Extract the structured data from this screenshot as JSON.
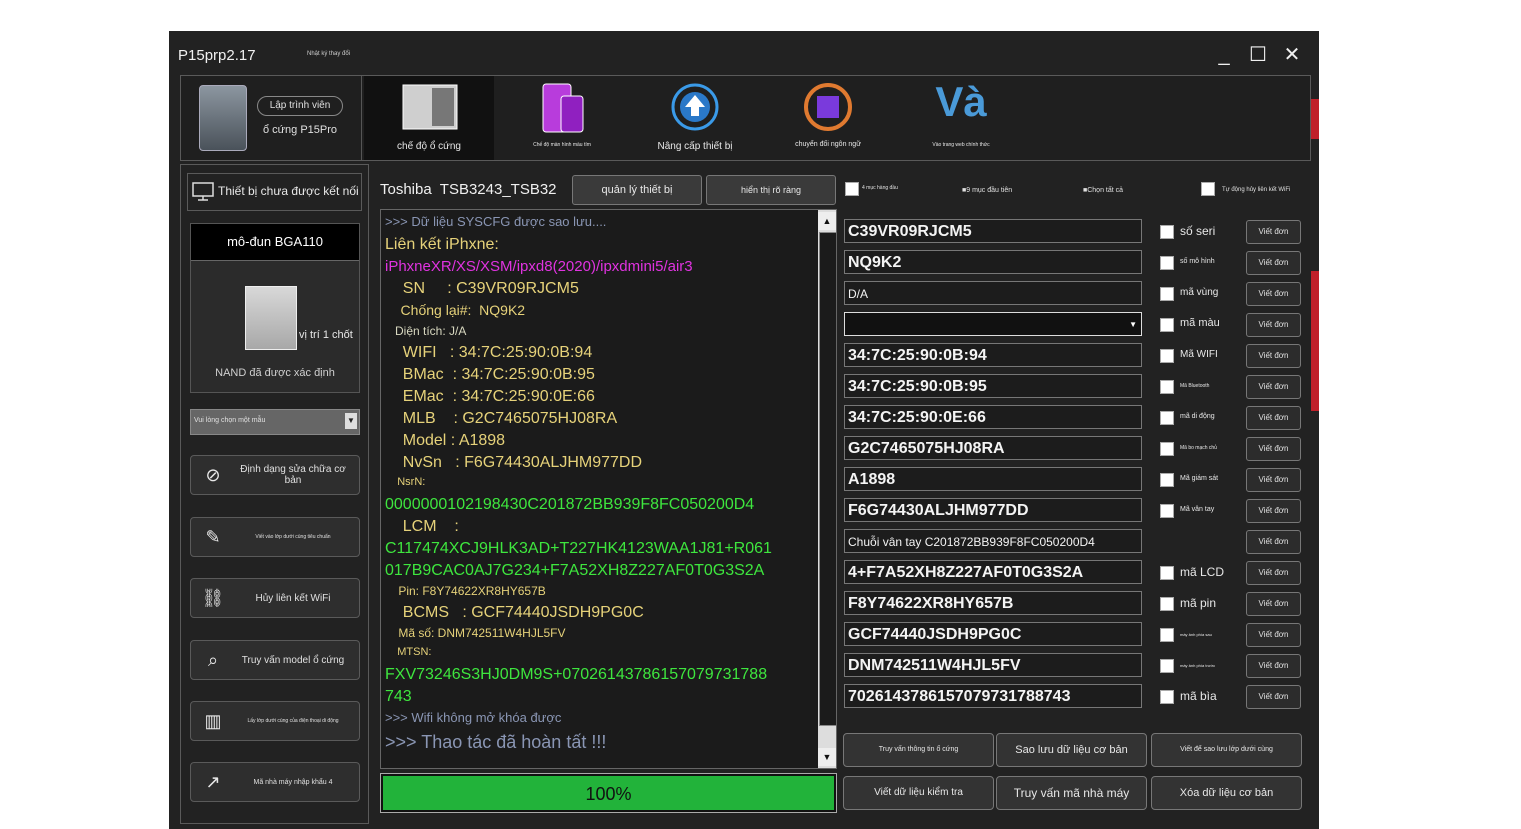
{
  "window": {
    "title": "P15prp2.17",
    "subtitle": "Nhật ký thay đổi",
    "controls": {
      "minimize": "_",
      "maximize": "☐",
      "close": "✕"
    }
  },
  "toolbar": {
    "device_pill": "Lập trình viên",
    "device_name": "ổ cứng P15Pro",
    "items": [
      {
        "label": "chế độ ổ cứng"
      },
      {
        "label": "Chế độ màn hình màu tím"
      },
      {
        "label": "Nâng cấp thiết bị"
      },
      {
        "label": "chuyển đổi ngôn ngữ"
      },
      {
        "label": "Vào trang web chính thức",
        "logo_text": "Và"
      }
    ]
  },
  "sidebar": {
    "connection_status": "Thiết bị chưa được kết nối",
    "module_title": "mô-đun BGA110",
    "position_label": "vị trí 1 chốt",
    "nand_status": "NAND đã được xác định",
    "model_select_placeholder": "Vui lòng chọn một mẫu",
    "buttons": [
      {
        "label": "Định dạng sửa chữa cơ bản",
        "icon": "format-icon"
      },
      {
        "label": "Viết vào lớp dưới cùng tiêu chuẩn",
        "icon": "edit-icon"
      },
      {
        "label": "Hủy liên kết WiFi",
        "icon": "unlink-icon"
      },
      {
        "label": "Truy vấn model ổ cứng",
        "icon": "query-icon"
      },
      {
        "label": "Lấy lớp dưới cùng của điện thoại di động",
        "icon": "phone-data-icon"
      },
      {
        "label": "Mã nhà máy nhập khẩu 4",
        "icon": "import-icon"
      }
    ]
  },
  "header": {
    "drive_name": "Toshiba",
    "drive_model": "TSB3243_TSB32",
    "manage_button": "quản lý thiết bị",
    "display_button": "hiển thị rõ ràng"
  },
  "log": {
    "lines": [
      {
        "text": ">>> Dữ liệu SYSCFG được sao lưu....",
        "color": "#8a96b4",
        "size": 13
      },
      {
        "text": "Liên kết iPhxne:",
        "color": "#e6d27a",
        "size": 16
      },
      {
        "text": "iPhxneXR/XS/XSM/ipxd8(2020)/ipxdmini5/air3",
        "color": "#e033e0",
        "size": 15
      },
      {
        "text": "    SN     : C39VR09RJCM5",
        "color": "#e6d27a",
        "size": 16
      },
      {
        "text": "    Chống lại#:  NQ9K2",
        "color": "#e6d27a",
        "size": 14
      },
      {
        "text": "   Diện tích: J/A",
        "color": "#d8d8c0",
        "size": 12
      },
      {
        "text": "    WIFI   : 34:7C:25:90:0B:94",
        "color": "#e6d27a",
        "size": 16
      },
      {
        "text": "    BMac  : 34:7C:25:90:0B:95",
        "color": "#e6d27a",
        "size": 16
      },
      {
        "text": "    EMac  : 34:7C:25:90:0E:66",
        "color": "#e6d27a",
        "size": 16
      },
      {
        "text": "    MLB    : G2C7465075HJ08RA",
        "color": "#e6d27a",
        "size": 16
      },
      {
        "text": "    Model : A1898",
        "color": "#e6d27a",
        "size": 16
      },
      {
        "text": "    NvSn   : F6G74430ALJHM977DD",
        "color": "#e6d27a",
        "size": 16
      },
      {
        "text": "    NsrN:",
        "color": "#e6d27a",
        "size": 11
      },
      {
        "text": "0000000102198430C201872BB939F8FC050200D4",
        "color": "#3ee63e",
        "size": 16
      },
      {
        "text": "    LCM    :",
        "color": "#e6d27a",
        "size": 16
      },
      {
        "text": "C117474XCJ9HLK3AD+T227HK4123WAA1J81+R061",
        "color": "#3ee63e",
        "size": 16
      },
      {
        "text": "017B9CAC0AJ7G234+F7A52XH8Z227AF0T0G3S2A",
        "color": "#3ee63e",
        "size": 16
      },
      {
        "text": "    Pin: F8Y74622XR8HY657B",
        "color": "#e6d27a",
        "size": 12
      },
      {
        "text": "    BCMS   : GCF74440JSDH9PG0C",
        "color": "#e6d27a",
        "size": 16
      },
      {
        "text": "    Mã số: DNM742511W4HJL5FV",
        "color": "#e6d27a",
        "size": 12
      },
      {
        "text": "    MTSN:",
        "color": "#e6d27a",
        "size": 11
      },
      {
        "text": "FXV73246S3HJ0DM9S+07026143786157079731788",
        "color": "#3ee63e",
        "size": 16
      },
      {
        "text": "743",
        "color": "#3ee63e",
        "size": 16
      },
      {
        "text": ">>> Wifi không mở khóa được",
        "color": "#8a96b4",
        "size": 13
      },
      {
        "text": ">>> Thao tác đã hoàn tất !!!",
        "color": "#8a96b4",
        "size": 18
      }
    ]
  },
  "progress": {
    "percent_label": "100%",
    "value": 1.0,
    "color": "#22b33a"
  },
  "options": {
    "first4": "4 mục hàng đầu",
    "first9": "9 mục đầu tiên",
    "select_all": "Chọn tất cả",
    "auto_unlink": "Tự động hủy liên kết WiFi"
  },
  "fields": [
    {
      "value": "C39VR09RJCM5",
      "label": "số seri",
      "label_size": 12,
      "checkbox": true
    },
    {
      "value": "NQ9K2",
      "label": "số mô hình",
      "label_size": 7,
      "checkbox": true
    },
    {
      "value": "D/A",
      "label": "mã vùng",
      "label_size": 10,
      "checkbox": true,
      "small": true
    },
    {
      "value": "",
      "label": "mã màu",
      "label_size": 11,
      "checkbox": true,
      "dropdown": true
    },
    {
      "value": "34:7C:25:90:0B:94",
      "label": "Mã WIFI",
      "label_size": 10,
      "checkbox": true
    },
    {
      "value": "34:7C:25:90:0B:95",
      "label": "Mã Bluetooth",
      "label_size": 5,
      "checkbox": true
    },
    {
      "value": "34:7C:25:90:0E:66",
      "label": "mã di động",
      "label_size": 7,
      "checkbox": true
    },
    {
      "value": "G2C7465075HJ08RA",
      "label": "Mã bo mạch chủ",
      "label_size": 5,
      "checkbox": true
    },
    {
      "value": "A1898",
      "label": "Mã giám sát",
      "label_size": 7,
      "checkbox": true
    },
    {
      "value": "F6G74430ALJHM977DD",
      "label": "Mã vân tay",
      "label_size": 7,
      "checkbox": true
    },
    {
      "value": "Chuỗi vân tay C201872BB939F8FC050200D4",
      "label": "",
      "label_size": 7,
      "checkbox": false,
      "small": true
    },
    {
      "value": "4+F7A52XH8Z227AF0T0G3S2A",
      "label": "mã LCD",
      "label_size": 12,
      "checkbox": true
    },
    {
      "value": "F8Y74622XR8HY657B",
      "label": "mã pin",
      "label_size": 12,
      "checkbox": true
    },
    {
      "value": "GCF74440JSDH9PG0C",
      "label": "máy ảnh phía sau",
      "label_size": 4,
      "checkbox": true
    },
    {
      "value": "DNM742511W4HJL5FV",
      "label": "máy ảnh phía trước",
      "label_size": 4,
      "checkbox": true
    },
    {
      "value": "7026143786157079731788743",
      "label": "mã bìa",
      "label_size": 12,
      "checkbox": true
    }
  ],
  "write_button_label": "Viết đơn",
  "bottom_buttons": [
    {
      "label": "Truy vấn thông tin ổ cứng",
      "size": 7
    },
    {
      "label": "Sao lưu dữ liệu cơ bản",
      "size": 11
    },
    {
      "label": "Viết để sao lưu lớp dưới cùng",
      "size": 7
    },
    {
      "label": "Viết dữ liệu kiểm tra",
      "size": 10
    },
    {
      "label": "Truy vấn mã nhà máy",
      "size": 12
    },
    {
      "label": "Xóa dữ liệu cơ bản",
      "size": 11
    }
  ]
}
